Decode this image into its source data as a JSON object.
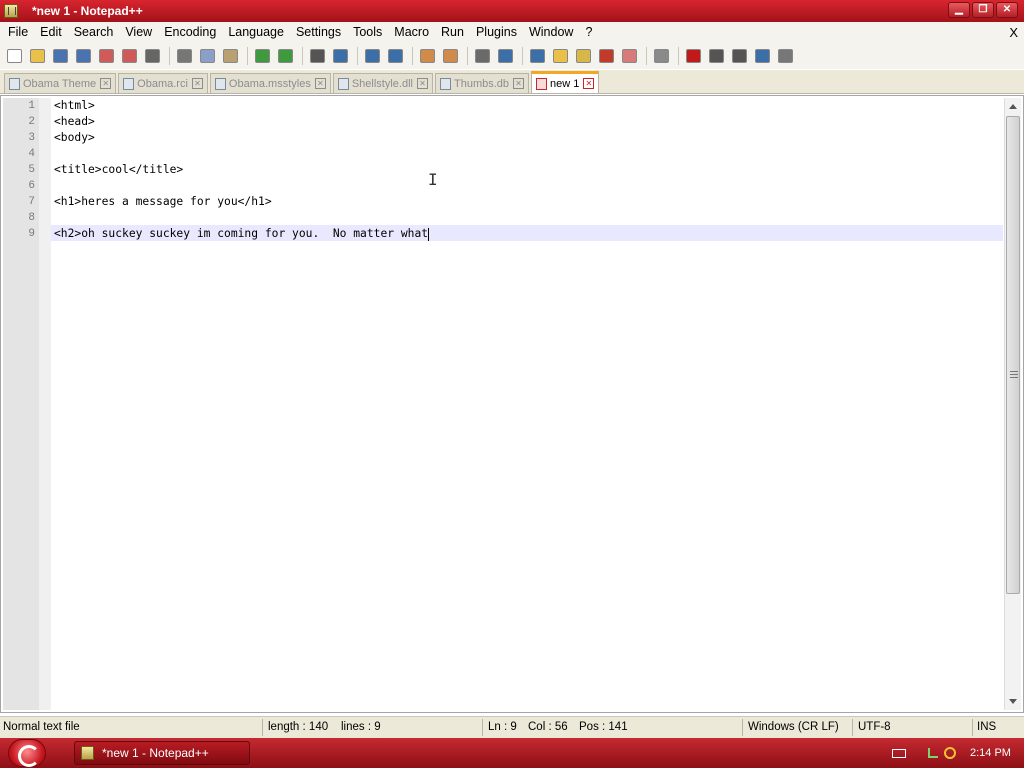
{
  "window": {
    "title": "*new 1 - Notepad++",
    "icon": "notepad-icon",
    "controls": {
      "minimize": "▁",
      "restore": "❐",
      "close": "✕"
    }
  },
  "menubar": {
    "items": [
      "File",
      "Edit",
      "Search",
      "View",
      "Encoding",
      "Language",
      "Settings",
      "Tools",
      "Macro",
      "Run",
      "Plugins",
      "Window",
      "?"
    ],
    "close_label": "X"
  },
  "toolbar": {
    "buttons": [
      {
        "name": "new-file-icon",
        "color": "#ffffff"
      },
      {
        "name": "open-file-icon",
        "color": "#e8c04a"
      },
      {
        "name": "save-icon",
        "color": "#4a72b0"
      },
      {
        "name": "save-all-icon",
        "color": "#4a72b0"
      },
      {
        "name": "close-icon",
        "color": "#cf5a5a"
      },
      {
        "name": "close-all-icon",
        "color": "#cf5a5a"
      },
      {
        "name": "print-icon",
        "color": "#666666"
      },
      {
        "name": "cut-icon",
        "color": "#777777"
      },
      {
        "name": "copy-icon",
        "color": "#8aa0c8"
      },
      {
        "name": "paste-icon",
        "color": "#b8a070"
      },
      {
        "name": "undo-icon",
        "color": "#3f9a3f"
      },
      {
        "name": "redo-icon",
        "color": "#3f9a3f"
      },
      {
        "name": "find-icon",
        "color": "#555555"
      },
      {
        "name": "replace-icon",
        "color": "#3c6ea8"
      },
      {
        "name": "zoom-in-icon",
        "color": "#3c6ea8"
      },
      {
        "name": "zoom-out-icon",
        "color": "#3c6ea8"
      },
      {
        "name": "sync-vertical-icon",
        "color": "#d08a4a"
      },
      {
        "name": "sync-horizontal-icon",
        "color": "#d08a4a"
      },
      {
        "name": "word-wrap-icon",
        "color": "#6a6a6a"
      },
      {
        "name": "show-all-chars-icon",
        "color": "#3c6ea8"
      },
      {
        "name": "indent-guide-icon",
        "color": "#3c6ea8"
      },
      {
        "name": "user-lang-icon",
        "color": "#e8c04a"
      },
      {
        "name": "doc-map-icon",
        "color": "#d6b84a"
      },
      {
        "name": "function-list-icon",
        "color": "#c23a2a"
      },
      {
        "name": "folder-workspace-icon",
        "color": "#d87a7a"
      },
      {
        "name": "monitoring-icon",
        "color": "#8a8a8a"
      },
      {
        "name": "record-macro-icon",
        "color": "#c21a1a"
      },
      {
        "name": "stop-record-icon",
        "color": "#555555"
      },
      {
        "name": "playback-icon",
        "color": "#555555"
      },
      {
        "name": "run-multiple-icon",
        "color": "#3c6ea8"
      },
      {
        "name": "save-macro-icon",
        "color": "#777777"
      }
    ]
  },
  "tabs": [
    {
      "label": "Obama Theme",
      "active": false
    },
    {
      "label": "Obama.rci",
      "active": false
    },
    {
      "label": "Obama.msstyles",
      "active": false
    },
    {
      "label": "Shellstyle.dll",
      "active": false
    },
    {
      "label": "Thumbs.db",
      "active": false
    },
    {
      "label": "new 1",
      "active": true
    }
  ],
  "editor": {
    "lines": [
      "<html>",
      "<head>",
      "<body>",
      "",
      "<title>cool</title>",
      "",
      "<h1>heres a message for you</h1>",
      "",
      "<h2>oh suckey suckey im coming for you.  No matter what"
    ],
    "current_line": 9
  },
  "statusbar": {
    "file_type": "Normal text file",
    "length": "length : 140",
    "lines": "lines : 9",
    "ln": "Ln : 9",
    "col": "Col : 56",
    "pos": "Pos : 141",
    "eol": "Windows (CR LF)",
    "encoding": "UTF-8",
    "mode": "INS"
  },
  "taskbar": {
    "task_label": "*new 1 - Notepad++",
    "clock": "2:14 PM"
  }
}
